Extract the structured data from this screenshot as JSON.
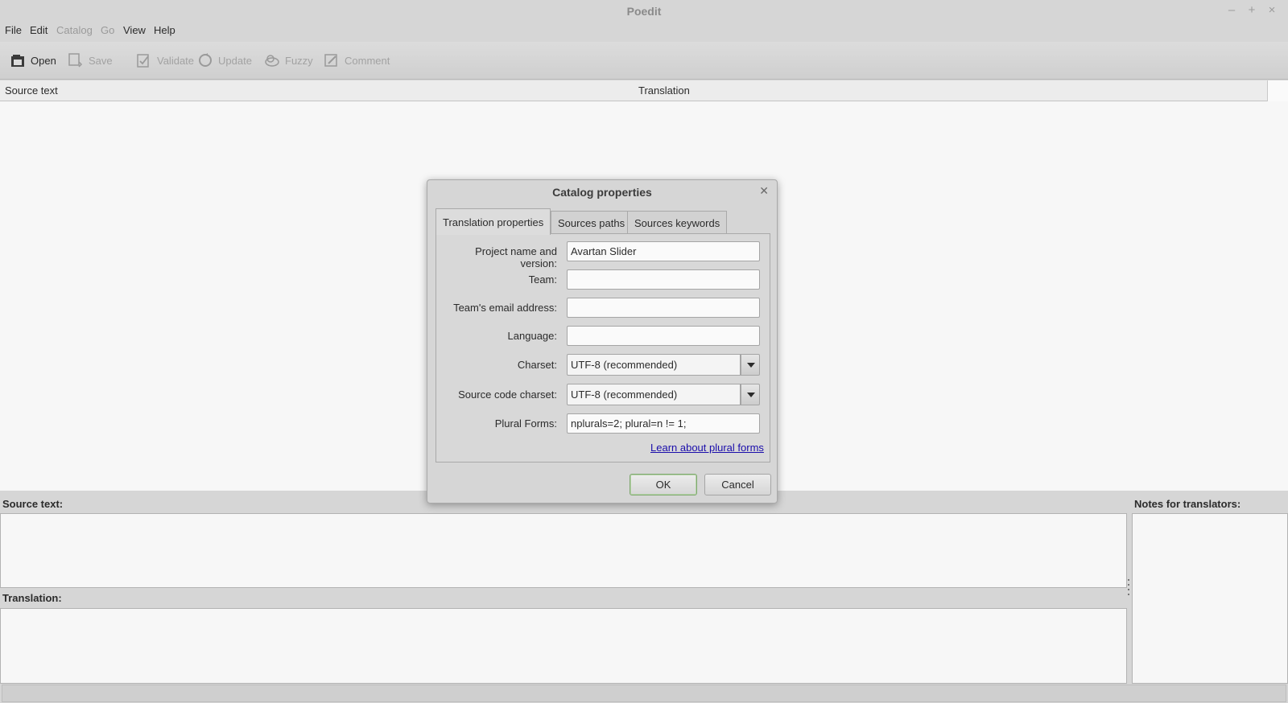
{
  "window": {
    "title": "Poedit",
    "controls": [
      "–",
      "+",
      "×"
    ]
  },
  "menu": [
    {
      "label": "File",
      "enabled": true
    },
    {
      "label": "Edit",
      "enabled": true
    },
    {
      "label": "Catalog",
      "enabled": false
    },
    {
      "label": "Go",
      "enabled": false
    },
    {
      "label": "View",
      "enabled": true
    },
    {
      "label": "Help",
      "enabled": true
    }
  ],
  "toolbar": {
    "open": "Open",
    "save": "Save",
    "validate": "Validate",
    "update": "Update",
    "fuzzy": "Fuzzy",
    "comment": "Comment"
  },
  "list": {
    "col_source": "Source text",
    "col_translation": "Translation"
  },
  "panels": {
    "source_label": "Source text:",
    "translation_label": "Translation:",
    "notes_label": "Notes for translators:"
  },
  "dialog": {
    "title": "Catalog properties",
    "tabs": [
      "Translation properties",
      "Sources paths",
      "Sources keywords"
    ],
    "fields": {
      "project_label": "Project name and version:",
      "project_value": "Avartan Slider",
      "team_label": "Team:",
      "team_value": "",
      "email_label": "Team's email address:",
      "email_value": "",
      "language_label": "Language:",
      "language_value": "",
      "charset_label": "Charset:",
      "charset_value": "UTF-8 (recommended)",
      "source_charset_label": "Source code charset:",
      "source_charset_value": "UTF-8 (recommended)",
      "plural_label": "Plural Forms:",
      "plural_value": "nplurals=2; plural=n != 1;"
    },
    "learn_link": "Learn about plural forms",
    "ok": "OK",
    "cancel": "Cancel"
  }
}
